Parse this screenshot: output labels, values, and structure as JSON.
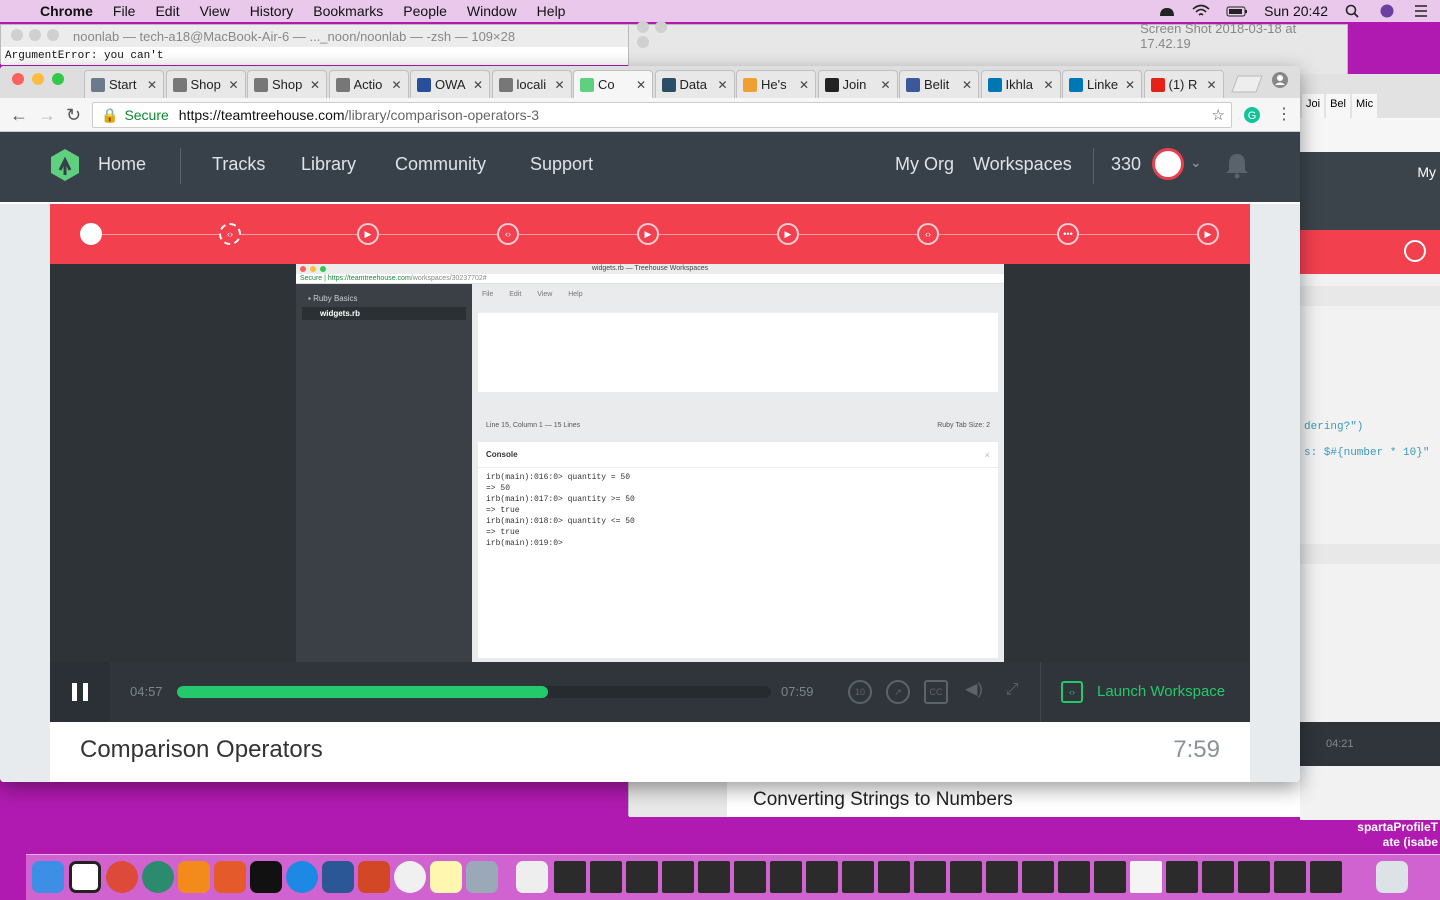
{
  "menubar": {
    "app": "Chrome",
    "items": [
      "File",
      "Edit",
      "View",
      "History",
      "Bookmarks",
      "People",
      "Window",
      "Help"
    ],
    "clock": "Sun 20:42"
  },
  "terminal": {
    "title": "noonlab — tech-a18@MacBook-Air-6 — ..._noon/noonlab — -zsh — 109×28",
    "line": "ArgumentError: you can't"
  },
  "screenshot_window": {
    "title": "Screen Shot 2018-03-18 at 17.42.19",
    "bottom_title": "Converting Strings to Numbers"
  },
  "right_window": {
    "tabs": [
      "Joi",
      "Bel",
      "Mic"
    ],
    "nav_item": "My",
    "code_lines": [
      "dering?\")",
      "s: $#{number * 10}\""
    ],
    "time": "04:21"
  },
  "tabs": [
    {
      "label": "Start",
      "color": "#6b7b8c"
    },
    {
      "label": "Shop",
      "color": "#777777"
    },
    {
      "label": "Shop",
      "color": "#777777"
    },
    {
      "label": "Actio",
      "color": "#777777"
    },
    {
      "label": "OWA",
      "color": "#2a4f9a"
    },
    {
      "label": "locali",
      "color": "#777777"
    },
    {
      "label": "Co",
      "color": "#5fcf80"
    },
    {
      "label": "Data",
      "color": "#2b4d66"
    },
    {
      "label": "He's",
      "color": "#f0a030"
    },
    {
      "label": "Join",
      "color": "#222222"
    },
    {
      "label": "Belit",
      "color": "#3b5998"
    },
    {
      "label": "Ikhla",
      "color": "#0077b5"
    },
    {
      "label": "Linke",
      "color": "#0077b5"
    },
    {
      "label": "(1) R",
      "color": "#e62117"
    }
  ],
  "address": {
    "secure_label": "Secure",
    "host": "https://teamtreehouse.com",
    "path": "/library/comparison-operators-3"
  },
  "nav": {
    "home": "Home",
    "tracks": "Tracks",
    "library": "Library",
    "community": "Community",
    "support": "Support",
    "my_org": "My Org",
    "workspaces": "Workspaces",
    "points": "330"
  },
  "workspace": {
    "window_title": "widgets.rb — Treehouse Workspaces",
    "secure": "Secure",
    "url_host": "https://teamtreehouse.com",
    "url_path": "/workspaces/30237702#",
    "folder": "Ruby Basics",
    "file": "widgets.rb",
    "menu": "File Edit View Help",
    "status_left": "Line 15, Column 1 — 15 Lines",
    "status_right": "Ruby     Tab Size: 2",
    "console_title": "Console",
    "console_text": "irb(main):016:0> quantity = 50\n=> 50\nirb(main):017:0> quantity >= 50\n=> true\nirb(main):018:0> quantity <= 50\n=> true\nirb(main):019:0>"
  },
  "player": {
    "current_time": "04:57",
    "total_time": "07:59",
    "progress": 0.625,
    "launch_label": "Launch Workspace",
    "accent": "#23c96a"
  },
  "video": {
    "title": "Comparison Operators",
    "duration": "7:59"
  },
  "dock_text": {
    "line1": "spartaProfileT",
    "line2": "ate (isabe"
  }
}
